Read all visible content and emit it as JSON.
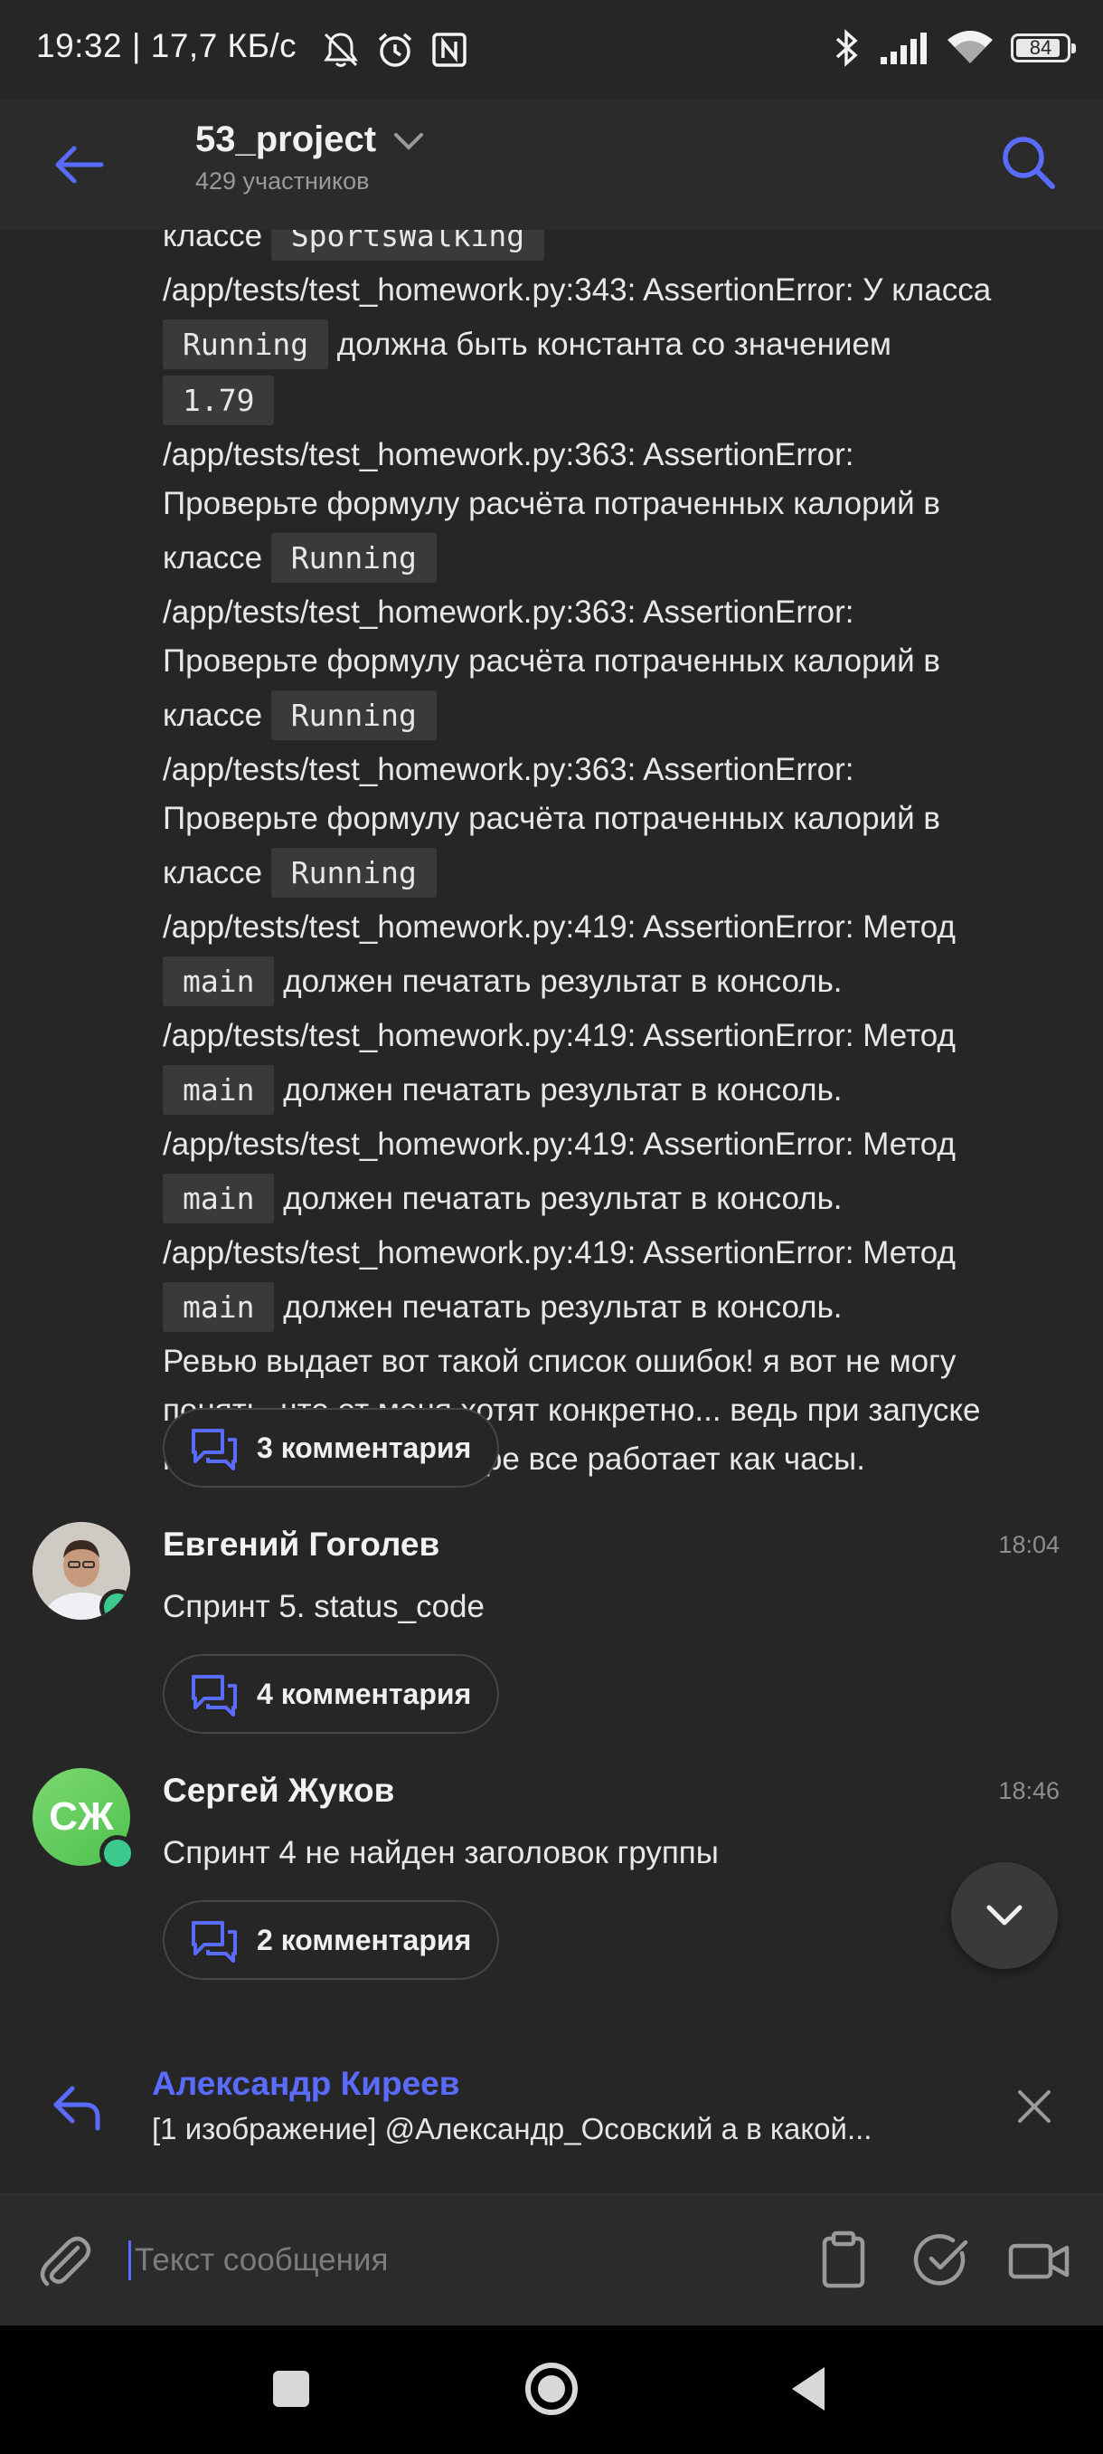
{
  "status_bar": {
    "time_speed": "19:32 | 17,7 КБ/с",
    "battery_level": "84",
    "icons": [
      "mute-icon",
      "alarm-icon",
      "nfc-icon",
      "bluetooth-icon",
      "signal-icon",
      "wifi-icon",
      "battery-icon"
    ]
  },
  "header": {
    "title": "53_project",
    "subtitle": "429 участников"
  },
  "thread_message": {
    "rows": [
      {
        "pre": "классе ",
        "code": "SportsWalking",
        "post": ""
      },
      {
        "pre": "/app/tests/test_homework.py:343: AssertionError: У класса",
        "code": "",
        "post": ""
      },
      {
        "pre": "",
        "code": "Running",
        "post": " должна быть константа со значением"
      },
      {
        "pre": "",
        "code": "1.79",
        "post": ""
      },
      {
        "pre": "/app/tests/test_homework.py:363: AssertionError:",
        "code": "",
        "post": ""
      },
      {
        "pre": "Проверьте формулу расчёта потраченных калорий в",
        "code": "",
        "post": ""
      },
      {
        "pre": "классе ",
        "code": "Running",
        "post": ""
      },
      {
        "pre": "/app/tests/test_homework.py:363: AssertionError:",
        "code": "",
        "post": ""
      },
      {
        "pre": "Проверьте формулу расчёта потраченных калорий в",
        "code": "",
        "post": ""
      },
      {
        "pre": "классе ",
        "code": "Running",
        "post": ""
      },
      {
        "pre": "/app/tests/test_homework.py:363: AssertionError:",
        "code": "",
        "post": ""
      },
      {
        "pre": "Проверьте формулу расчёта потраченных калорий в",
        "code": "",
        "post": ""
      },
      {
        "pre": "классе ",
        "code": "Running",
        "post": ""
      },
      {
        "pre": "/app/tests/test_homework.py:419: AssertionError: Метод",
        "code": "",
        "post": ""
      },
      {
        "pre": "",
        "code": "main",
        "post": " должен печатать результат в консоль."
      },
      {
        "pre": "/app/tests/test_homework.py:419: AssertionError: Метод",
        "code": "",
        "post": ""
      },
      {
        "pre": "",
        "code": "main",
        "post": " должен печатать результат в консоль."
      },
      {
        "pre": "/app/tests/test_homework.py:419: AssertionError: Метод",
        "code": "",
        "post": ""
      },
      {
        "pre": "",
        "code": "main",
        "post": " должен печатать результат в консоль."
      },
      {
        "pre": "/app/tests/test_homework.py:419: AssertionError: Метод",
        "code": "",
        "post": ""
      },
      {
        "pre": "",
        "code": "main",
        "post": " должен печатать результат в консоль."
      },
      {
        "pre": "Ревью выдает вот такой список ошибок! я вот не могу",
        "code": "",
        "post": ""
      },
      {
        "pre": "понять, что от меня хотят конкретно... ведь при запуске",
        "code": "",
        "post": ""
      },
      {
        "pre": "проверки на винчестере все работает как часы.",
        "code": "",
        "post": ""
      }
    ],
    "comments_label": "3 комментария"
  },
  "messages": [
    {
      "author": "Евгений Гоголев",
      "time": "18:04",
      "text": "Спринт 5. status_code",
      "comments_label": "4 комментария",
      "avatar_initials": ""
    },
    {
      "author": "Сергей Жуков",
      "time": "18:46",
      "text": "Спринт 4 не найден заголовок группы",
      "comments_label": "2 комментария",
      "avatar_initials": "СЖ"
    }
  ],
  "reply": {
    "author": "Александр Киреев",
    "text": "[1 изображение] @Александр_Осовский а в какой..."
  },
  "composer": {
    "placeholder": "Текст сообщения"
  },
  "colors": {
    "accent": "#5a6cff",
    "background": "#262626",
    "online": "#3cc98e"
  }
}
